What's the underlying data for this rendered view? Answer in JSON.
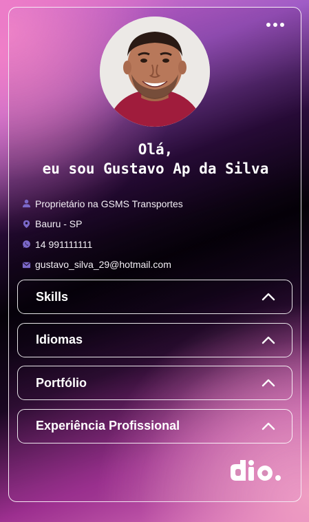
{
  "profile": {
    "greeting_line1": "Olá,",
    "greeting_line2": "eu sou Gustavo Ap da Silva",
    "avatar_icon": "profile-photo"
  },
  "info": [
    {
      "icon": "user-icon",
      "text": "Proprietário na GSMS Transportes"
    },
    {
      "icon": "location-pin-icon",
      "text": "Bauru - SP"
    },
    {
      "icon": "whatsapp-icon",
      "text": "14 991111111"
    },
    {
      "icon": "mail-icon",
      "text": "gustavo_silva_29@hotmail.com"
    }
  ],
  "sections": [
    {
      "label": "Skills"
    },
    {
      "label": "Idiomas"
    },
    {
      "label": "Portfólio"
    },
    {
      "label": "Experiência Profissional"
    }
  ],
  "colors": {
    "accent_pink": "#e573c9",
    "icon_purple": "#7b68c8",
    "text": "#ffffff"
  },
  "branding": {
    "logo_text": "dio."
  }
}
